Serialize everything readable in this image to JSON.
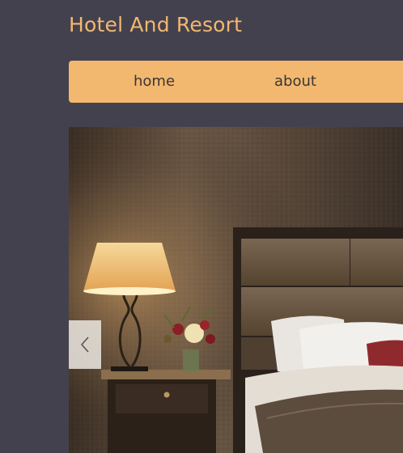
{
  "site": {
    "title": "Hotel And Resort"
  },
  "nav": {
    "items": [
      {
        "label": "home"
      },
      {
        "label": "about"
      }
    ]
  },
  "hero": {
    "icon": "chevron-left-icon"
  },
  "colors": {
    "background": "#44414f",
    "accent": "#f2b86f",
    "nav_text": "#3a3636"
  }
}
